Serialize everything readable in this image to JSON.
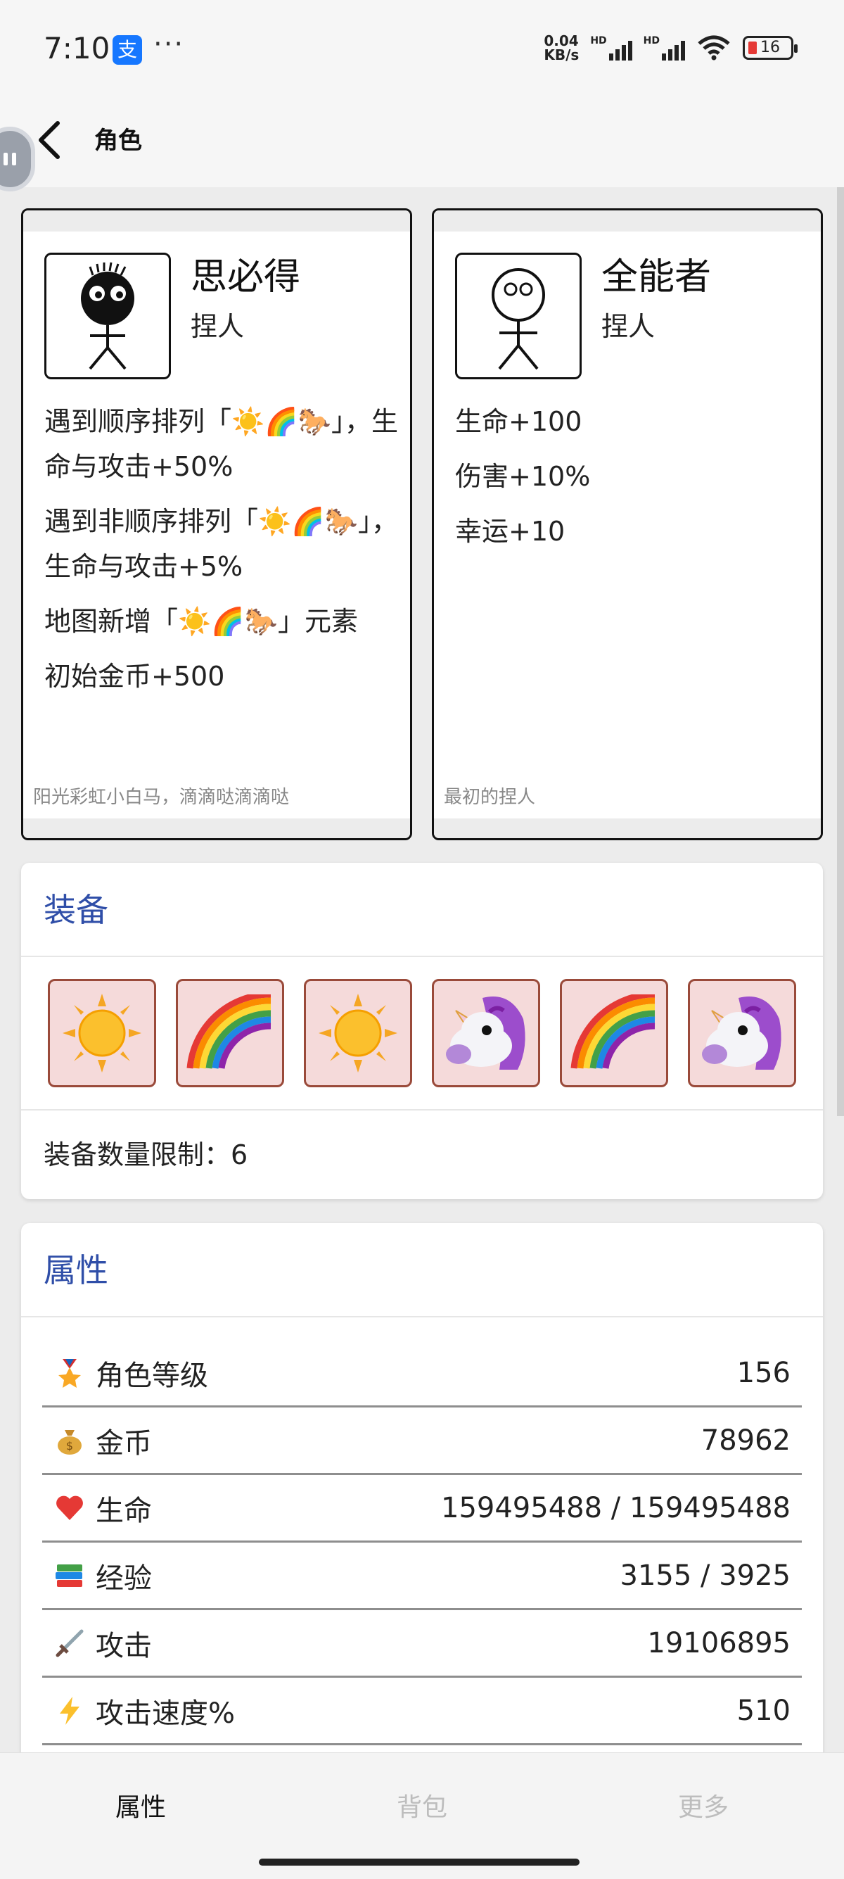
{
  "status": {
    "time": "7:10",
    "pay_icon": "支",
    "more": "···",
    "net_speed_value": "0.04",
    "net_speed_unit": "KB/s",
    "hd1": "HD",
    "hd2": "HD",
    "battery": "16"
  },
  "appbar": {
    "title": "角色"
  },
  "characters": [
    {
      "name": "思必得",
      "type": "捏人",
      "skills": [
        "遇到顺序排列「☀️🌈🐎」，生命与攻击+50%",
        "遇到非顺序排列「☀️🌈🐎」，生命与攻击+5%",
        "地图新增「☀️🌈🐎」元素",
        "初始金币+500"
      ],
      "desc": "阳光彩虹小白马，滴滴哒滴滴哒"
    },
    {
      "name": "全能者",
      "type": "捏人",
      "skills": [
        "生命+100",
        "伤害+10%",
        "幸运+10"
      ],
      "desc": "最初的捏人"
    }
  ],
  "equipment": {
    "title": "装备",
    "slots": [
      "☀️",
      "🌈",
      "☀️",
      "🦄",
      "🌈",
      "🦄"
    ],
    "limit_text": "装备数量限制：6"
  },
  "attributes": {
    "title": "属性",
    "rows": [
      {
        "icon": "🎖️",
        "label": "角色等级",
        "value": "156"
      },
      {
        "icon": "💰",
        "label": "金币",
        "value": "78962"
      },
      {
        "icon": "❤️",
        "label": "生命",
        "value": "159495488 / 159495488"
      },
      {
        "icon": "📚",
        "label": "经验",
        "value": "3155 / 3925"
      },
      {
        "icon": "🗡️",
        "label": "攻击",
        "value": "19106895"
      },
      {
        "icon": "⚡",
        "label": "攻击速度%",
        "value": "510"
      }
    ]
  },
  "nav": {
    "tab1": "属性",
    "tab2": "背包",
    "tab3": "更多"
  },
  "colors": {
    "accent": "#2f4ea8",
    "equip_bg": "#f5dada",
    "equip_border": "#9a4a3a"
  }
}
